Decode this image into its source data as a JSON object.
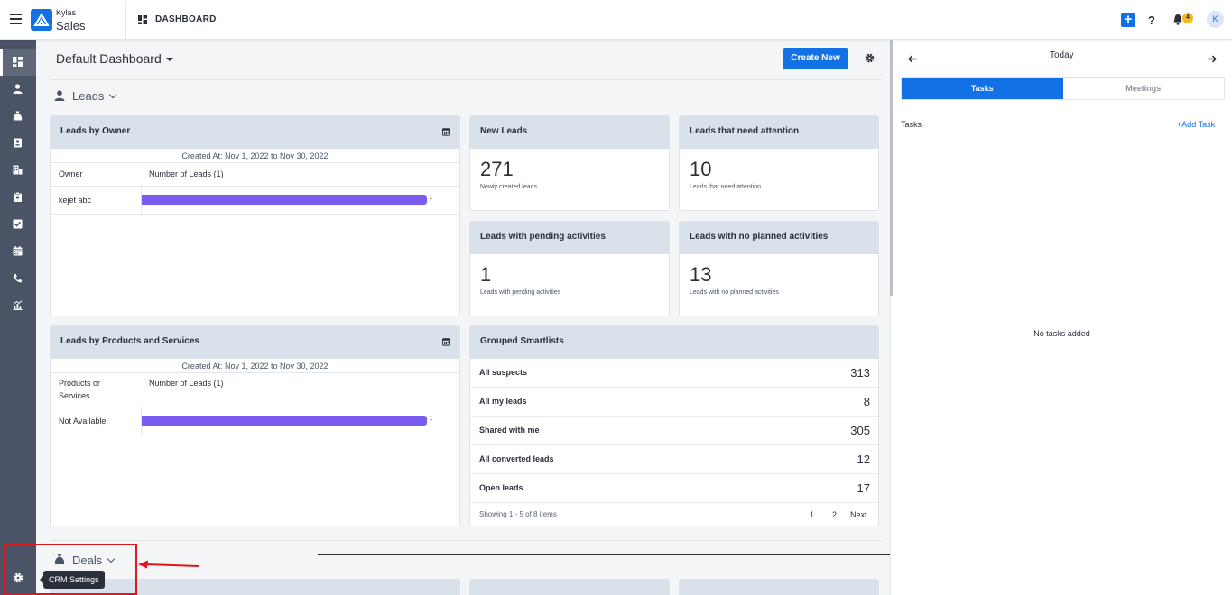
{
  "header": {
    "brand_top": "Kylas",
    "brand_bottom": "Sales",
    "page_label": "DASHBOARD",
    "plus_label": "+",
    "help_label": "?",
    "notification_count": "4",
    "avatar_initial": "K"
  },
  "sidebar": {
    "items": [
      {
        "name": "dashboard",
        "icon": "dashboard-icon",
        "active": true
      },
      {
        "name": "leads",
        "icon": "person-icon"
      },
      {
        "name": "deals",
        "icon": "money-bag-icon"
      },
      {
        "name": "contacts",
        "icon": "contact-card-icon"
      },
      {
        "name": "companies",
        "icon": "building-icon"
      },
      {
        "name": "products",
        "icon": "clipboard-icon"
      },
      {
        "name": "tasks",
        "icon": "checkbox-icon"
      },
      {
        "name": "meetings",
        "icon": "calendar-icon"
      },
      {
        "name": "calls",
        "icon": "phone-icon"
      },
      {
        "name": "reports",
        "icon": "chart-icon"
      }
    ],
    "settings_tooltip": "CRM Settings"
  },
  "dashboard": {
    "title": "Default Dashboard",
    "create_button": "Create New",
    "leads_section": "Leads",
    "deals_section": "Deals",
    "leads_by_owner": {
      "title": "Leads by Owner",
      "created_at": "Created At: Nov 1, 2022 to Nov 30, 2022",
      "col1": "Owner",
      "col2": "Number of Leads (1)",
      "rows": [
        {
          "label": "kejet abc",
          "value": "1",
          "fraction": 1.0
        }
      ]
    },
    "leads_by_products": {
      "title": "Leads by Products and Services",
      "created_at": "Created At: Nov 1, 2022 to Nov 30, 2022",
      "col1": "Products or Services",
      "col2": "Number of Leads (1)",
      "rows": [
        {
          "label": "Not Available",
          "value": "1",
          "fraction": 1.0
        }
      ]
    },
    "stats": [
      {
        "title": "New Leads",
        "value": "271",
        "sub": "Newly created leads"
      },
      {
        "title": "Leads that need attention",
        "value": "10",
        "sub": "Leads that need attention"
      },
      {
        "title": "Leads with pending activities",
        "value": "1",
        "sub": "Leads with pending activities"
      },
      {
        "title": "Leads with no planned activities",
        "value": "13",
        "sub": "Leads with no planned activities"
      }
    ],
    "smartlists": {
      "title": "Grouped Smartlists",
      "rows": [
        {
          "label": "All suspects",
          "count": "313"
        },
        {
          "label": "All my leads",
          "count": "8"
        },
        {
          "label": "Shared with me",
          "count": "305"
        },
        {
          "label": "All converted leads",
          "count": "12"
        },
        {
          "label": "Open leads",
          "count": "17"
        }
      ],
      "showing": "Showing 1 - 5 of 8 items",
      "page1": "1",
      "page2": "2",
      "next": "Next"
    }
  },
  "right_panel": {
    "today": "Today",
    "tab_tasks": "Tasks",
    "tab_meetings": "Meetings",
    "tasks_label": "Tasks",
    "add_task": "+Add Task",
    "empty": "No tasks added"
  },
  "colors": {
    "accent": "#1371e6",
    "sidebar": "#4b5466",
    "bar": "#7b5cf0",
    "card_header": "#d9e1ea",
    "annotation": "#e0161c"
  }
}
